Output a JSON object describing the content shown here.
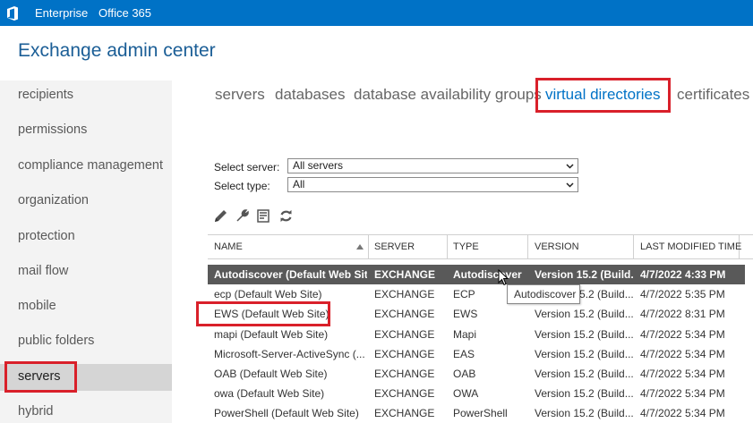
{
  "topbar": {
    "logo_icon": "office-logo-icon",
    "links": [
      "Enterprise",
      "Office 365"
    ],
    "bg_color": "#0072c6"
  },
  "app": {
    "title": "Exchange admin center"
  },
  "nav": {
    "items": [
      "recipients",
      "permissions",
      "compliance management",
      "organization",
      "protection",
      "mail flow",
      "mobile",
      "public folders",
      "servers",
      "hybrid"
    ],
    "selected": "servers"
  },
  "tabs": {
    "items": [
      "servers",
      "databases",
      "database availability groups",
      "virtual directories",
      "certificates"
    ],
    "active": "virtual directories"
  },
  "filters": {
    "server_label": "Select server:",
    "server_value": "All servers",
    "type_label": "Select type:",
    "type_value": "All"
  },
  "toolbar": {
    "icons": [
      "edit-icon",
      "wrench-icon",
      "reset-icon",
      "refresh-icon"
    ]
  },
  "grid": {
    "columns": [
      "NAME",
      "SERVER",
      "TYPE",
      "VERSION",
      "LAST MODIFIED TIME"
    ],
    "sort_column": "NAME",
    "sort_direction": "ascending",
    "rows": [
      [
        "Autodiscover (Default Web Site)",
        "EXCHANGE",
        "Autodiscover",
        "Version 15.2 (Build...",
        "4/7/2022 4:33 PM"
      ],
      [
        "ecp (Default Web Site)",
        "EXCHANGE",
        "ECP",
        "Version 15.2 (Build...",
        "4/7/2022 5:35 PM"
      ],
      [
        "EWS (Default Web Site)",
        "EXCHANGE",
        "EWS",
        "Version 15.2 (Build...",
        "4/7/2022 8:31 PM"
      ],
      [
        "mapi (Default Web Site)",
        "EXCHANGE",
        "Mapi",
        "Version 15.2 (Build...",
        "4/7/2022 5:34 PM"
      ],
      [
        "Microsoft-Server-ActiveSync (...",
        "EXCHANGE",
        "EAS",
        "Version 15.2 (Build...",
        "4/7/2022 5:34 PM"
      ],
      [
        "OAB (Default Web Site)",
        "EXCHANGE",
        "OAB",
        "Version 15.2 (Build...",
        "4/7/2022 5:34 PM"
      ],
      [
        "owa (Default Web Site)",
        "EXCHANGE",
        "OWA",
        "Version 15.2 (Build...",
        "4/7/2022 5:34 PM"
      ],
      [
        "PowerShell (Default Web Site)",
        "EXCHANGE",
        "PowerShell",
        "Version 15.2 (Build...",
        "4/7/2022 5:34 PM"
      ]
    ],
    "selected_row": 0
  },
  "tooltip": {
    "text": "Autodiscover"
  },
  "colors": {
    "accent": "#0072c6",
    "highlight_red": "#d9202a",
    "selected_row_bg": "#595959"
  }
}
